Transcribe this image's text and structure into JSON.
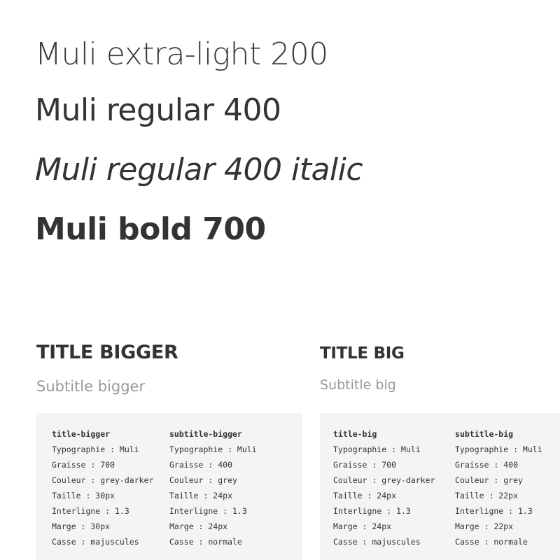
{
  "samples": {
    "light": "Muli extra-light 200",
    "regular": "Muli regular 400",
    "italic": "Muli regular 400 italic",
    "bold": "Muli bold 700"
  },
  "blocks": [
    {
      "title": "TITLE BIGGER",
      "subtitle": "Subtitle bigger",
      "specs": [
        {
          "name": "title-bigger",
          "lines": [
            "Typographie : Muli",
            "Graisse : 700",
            "Couleur : grey-darker",
            "Taille : 30px",
            "Interligne : 1.3",
            "Marge : 30px",
            "Casse : majuscules"
          ]
        },
        {
          "name": "subtitle-bigger",
          "lines": [
            "Typographie : Muli",
            "Graisse : 400",
            "Couleur : grey",
            "Taille : 24px",
            "Interligne : 1.3",
            "Marge : 24px",
            "Casse : normale"
          ]
        }
      ]
    },
    {
      "title": "TITLE BIG",
      "subtitle": "Subtitle big",
      "specs": [
        {
          "name": "title-big",
          "lines": [
            "Typographie : Muli",
            "Graisse : 700",
            "Couleur : grey-darker",
            "Taille : 24px",
            "Interligne : 1.3",
            "Marge : 24px",
            "Casse : majuscules"
          ]
        },
        {
          "name": "subtitle-big",
          "lines": [
            "Typographie : Muli",
            "Graisse : 400",
            "Couleur : grey",
            "Taille : 22px",
            "Interligne : 1.3",
            "Marge : 22px",
            "Casse : normale"
          ]
        }
      ]
    }
  ],
  "colors": {
    "grey_darker": "#333333",
    "grey": "#999999",
    "panel_background": "#f4f4f4"
  }
}
